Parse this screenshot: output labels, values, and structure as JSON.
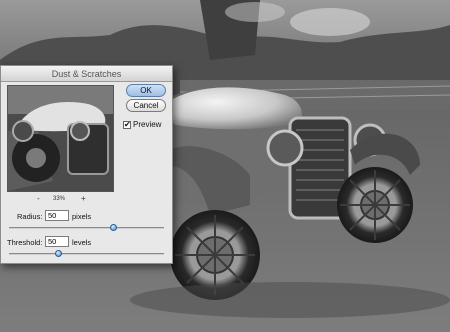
{
  "dialog": {
    "title": "Dust & Scratches",
    "ok_label": "OK",
    "cancel_label": "Cancel",
    "preview_label": "Preview",
    "preview_checked": true,
    "preview_check_glyph": "✔",
    "zoom_out_label": "-",
    "zoom_level": "33%",
    "zoom_in_label": "+"
  },
  "radius": {
    "label": "Radius:",
    "value": "50",
    "unit": "pixels",
    "slider_fraction": 0.68
  },
  "threshold": {
    "label": "Threshold:",
    "value": "50",
    "unit": "levels",
    "slider_fraction": 0.32
  },
  "colors": {
    "ok_accent": "#9ebfe4",
    "slider_thumb": "#4f86c6"
  },
  "icons": [
    "checkbox-check-icon",
    "zoom-out-icon",
    "zoom-in-icon"
  ]
}
